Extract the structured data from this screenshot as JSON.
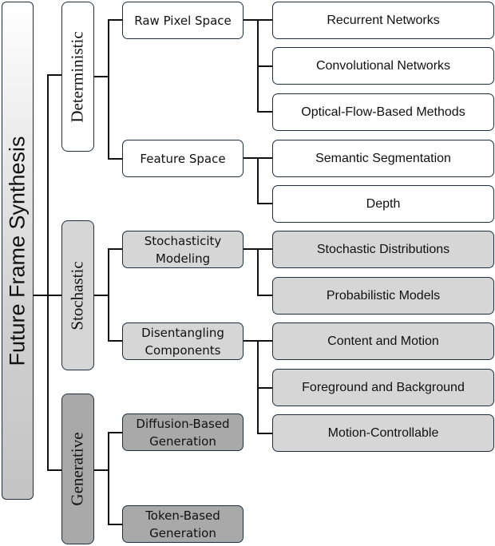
{
  "diagram": {
    "root": {
      "label": "Future Frame Synthesis"
    },
    "branches": [
      {
        "label": "Deterministic",
        "children": [
          {
            "label": "Raw Pixel Space",
            "leaves": [
              "Recurrent Networks",
              "Convolutional Networks",
              "Optical-Flow-Based Methods"
            ]
          },
          {
            "label": "Feature Space",
            "leaves": [
              "Semantic Segmentation",
              "Depth"
            ]
          }
        ]
      },
      {
        "label": "Stochastic",
        "children": [
          {
            "label": "Stochasticity Modeling",
            "leaves": [
              "Stochastic Distributions",
              "Probabilistic Models"
            ]
          },
          {
            "label": "Disentangling Components",
            "leaves": [
              "Content and Motion",
              "Foreground and Background",
              "Motion-Controllable"
            ]
          }
        ]
      },
      {
        "label": "Generative",
        "children": [
          {
            "label": "Diffusion-Based Generation",
            "leaves": []
          },
          {
            "label": "Token-Based Generation",
            "leaves": []
          }
        ]
      }
    ],
    "colors": {
      "border": "#1f2d3d",
      "deterministic_fill": "#ffffff",
      "stochastic_fill": "#d6d6d6",
      "generative_fill": "#a9a9a9"
    }
  }
}
